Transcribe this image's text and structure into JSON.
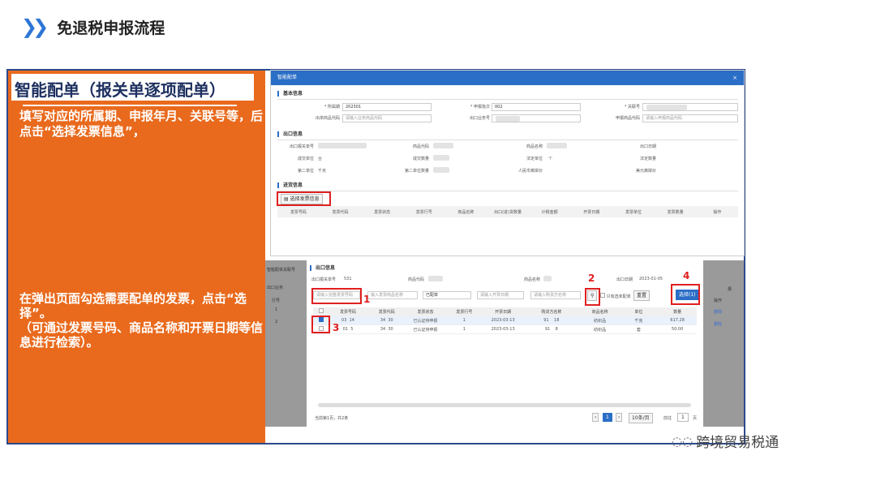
{
  "header": {
    "chevron": "❯❯",
    "title": "免退税申报流程"
  },
  "left": {
    "title": "智能配单（报关单逐项配单）",
    "text1": "填写对应的所属期、申报年月、关联号等，后点击“选择发票信息”，",
    "text2": "在弹出页面勾选需要配单的发票，点击“选择”。\n（可通过发票号码、商品名称和开票日期等信息进行检索）。"
  },
  "dialog1": {
    "title": "智能配单",
    "close": "×",
    "sec_basic": "基本信息",
    "basic_fields": [
      {
        "label": "* 所属期",
        "value": "202301"
      },
      {
        "label": "* 申报批次",
        "value": "002"
      },
      {
        "label": "* 关联号",
        "value": ""
      },
      {
        "label": "出单商品代码",
        "value": "请输入业务商品代码"
      },
      {
        "label": "出口业务号",
        "value": ""
      },
      {
        "label": "申报商品代码",
        "value": "请输入申报商品代码"
      }
    ],
    "sec_export": "出口信息",
    "export_fields": [
      "出口报关单号",
      "商品代码",
      "商品名称",
      "出口日期",
      "成交单位",
      "成交数量",
      "法定单位",
      "法定数量",
      "第二单位",
      "第二单位数量",
      "人民币离岸价",
      "美元离岸价"
    ],
    "export_values": {
      "unit": "台",
      "legal_unit": "个",
      "second_unit": "千克"
    },
    "sec_purchase": "进货信息",
    "select_invoice_btn": "选择发票信息",
    "table_headers": [
      "发票号码",
      "发票代码",
      "发票状态",
      "发票行号",
      "商品名称",
      "出口(进)货数量",
      "计税金额",
      "开票日期",
      "发票单位",
      "发票数量",
      "操作"
    ]
  },
  "dialog2": {
    "export_info": "出口信息",
    "export_no_label": "出口报关单号",
    "export_no": "531",
    "product_code_label": "商品代码",
    "product_name_label": "商品名称",
    "export_date_label": "出口日期",
    "export_date": "2023-01-05",
    "filters": {
      "invoice_no": "请输入完整发票号码",
      "product": "输入发票商品名称",
      "status": "已配单",
      "issuer": "请输入开票日期",
      "buyer": "请输入购货方名称"
    },
    "search_icon": "search-icon",
    "checkbox_label": "只有选未配单",
    "reset": "重置",
    "select_btn": "选择(1)",
    "headers": [
      "",
      "发票号码",
      "发票代码",
      "发票状态",
      "发票行号",
      "开票日期",
      "购货方名称",
      "商品名称",
      "单位",
      "数量"
    ],
    "rows": [
      {
        "checked": true,
        "cells": [
          "03",
          "14",
          "34",
          "30",
          "已认证待申报",
          "1",
          "2023-03-13",
          "91",
          "18",
          "纺织品",
          "千克",
          "617.28"
        ]
      },
      {
        "checked": false,
        "cells": [
          "01",
          "5",
          "34",
          "30",
          "已认证待申报",
          "1",
          "2023-03-13",
          "91",
          "8",
          "纺织品",
          "套",
          "50.00"
        ]
      }
    ],
    "footer": "当前第1页，共2条",
    "page": "1",
    "per_page": "10条/页",
    "goto": "前往",
    "goto_page": "1",
    "page_unit": "页",
    "bg_side": [
      "智能配单关联号",
      "出口业务",
      "行号",
      "1",
      "2"
    ],
    "bg_right": [
      "报",
      "操作",
      "删除",
      "删除"
    ]
  },
  "markers": [
    "1",
    "2",
    "3",
    "4"
  ],
  "watermark": "跨境贸易税通",
  "colors": {
    "accent": "#2b6ec7",
    "orange": "#e96a1d",
    "red": "#e02020",
    "frame": "#2d4a8c"
  }
}
